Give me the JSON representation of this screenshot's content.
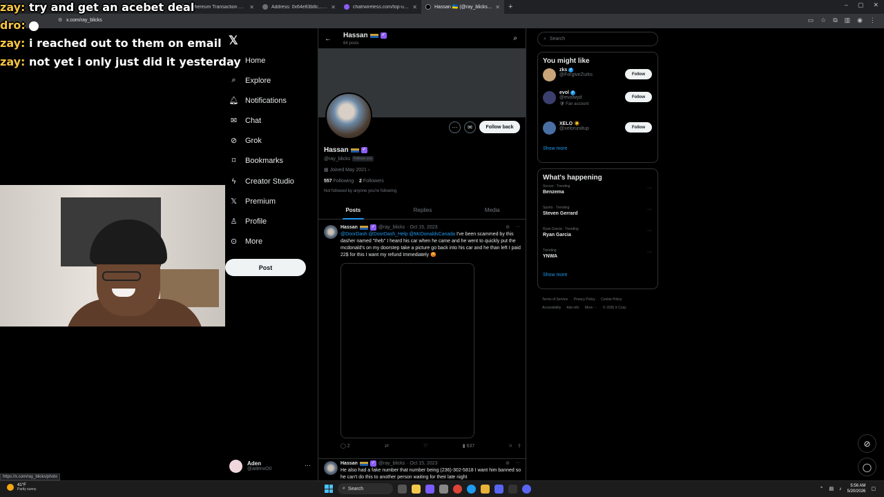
{
  "browser": {
    "tabs": [
      {
        "title": "",
        "active": false
      },
      {
        "title": "Ethereum Transaction Hash (Tx...",
        "active": false
      },
      {
        "title": "Address: 0x64e83b8c...b8583f...",
        "active": false
      },
      {
        "title": "chatrwireless.com/top-up/gue...",
        "active": false
      },
      {
        "title": "Hassan 🇺🇦 (@ray_blicks) / X",
        "active": true
      }
    ],
    "url": "x.com/ray_blicks",
    "status_url": "https://x.com/ray_blicks/photo"
  },
  "stream_chat": [
    {
      "name": "zay:",
      "text": "try and get an acebet deal"
    },
    {
      "name": "dro:",
      "text": ""
    },
    {
      "name": "zay:",
      "text": "i reached out to them on email"
    },
    {
      "name": "zay:",
      "text": "not yet i only just did it yesterday"
    }
  ],
  "nav": {
    "items": [
      {
        "label": "Home",
        "icon": "home-icon"
      },
      {
        "label": "Explore",
        "icon": "search-icon"
      },
      {
        "label": "Notifications",
        "icon": "bell-icon"
      },
      {
        "label": "Chat",
        "icon": "mail-icon"
      },
      {
        "label": "Grok",
        "icon": "grok-icon"
      },
      {
        "label": "Bookmarks",
        "icon": "bookmark-icon"
      },
      {
        "label": "Creator Studio",
        "icon": "lightning-icon"
      },
      {
        "label": "Premium",
        "icon": "x-icon"
      },
      {
        "label": "Profile",
        "icon": "person-icon"
      },
      {
        "label": "More",
        "icon": "more-circle-icon"
      }
    ],
    "post_label": "Post",
    "account": {
      "name": "Aden",
      "handle": "@adenxO0"
    }
  },
  "profile": {
    "header_name": "Hassan",
    "post_count": "64 posts",
    "name": "Hassan",
    "handle": "@ray_blicks",
    "follows_you": "Follows you",
    "joined": "Joined May 2021",
    "following_count": "557",
    "following_label": "Following",
    "followers_count": "2",
    "followers_label": "Followers",
    "not_followed": "Not followed by anyone you're following",
    "follow_back_label": "Follow back",
    "tabs": [
      "Posts",
      "Replies",
      "Media"
    ]
  },
  "tweets": [
    {
      "name": "Hassan",
      "handle": "@ray_blicks",
      "date": "· Oct 15, 2023",
      "mentions": "@DoorDash @DoorDash_Help @McDonaldsCanada",
      "text": " I've been scammed by this dasher named \"Iheb\" I heard his car when he came and he went to quickly put the mcdonald's on my doorstep take a picture go back into his car and he than left I paid 22$ for this I want my refund Immediately 😡",
      "replies": "2",
      "views": "637"
    },
    {
      "name": "Hassan",
      "handle": "@ray_blicks",
      "date": "· Oct 15, 2023",
      "mentions": "",
      "text": "He also had a fake number that number being (236)-302-5818 I want him banned so he can't do this to another person waiting for their late night"
    }
  ],
  "right": {
    "search_placeholder": "Search",
    "wtf_title": "You might like",
    "wtf": [
      {
        "name": "zks",
        "handle": "@ForgiveZurks",
        "sub": "",
        "verified": true,
        "color": "#c9a47a"
      },
      {
        "name": "evol",
        "handle": "@evolwyd",
        "sub": "Fan account",
        "verified": true,
        "color": "#3b3f6e"
      },
      {
        "name": "XELO ☀️",
        "handle": "@xeloruniitup",
        "sub": "",
        "verified": false,
        "color": "#4a6fa5"
      }
    ],
    "follow_label": "Follow",
    "show_more": "Show more",
    "happening_title": "What's happening",
    "trends": [
      {
        "context": "Soccer · Trending",
        "title": "Benzema"
      },
      {
        "context": "Sports · Trending",
        "title": "Steven Gerrard"
      },
      {
        "context": "Ryan Garcia · Trending",
        "title": "Ryan Garcia"
      },
      {
        "context": "Trending",
        "title": "YNWA"
      }
    ],
    "footer": [
      "Terms of Service",
      "Privacy Policy",
      "Cookie Policy",
      "Accessibility",
      "Ads info",
      "More ···",
      "© 2026 X Corp."
    ]
  },
  "taskbar": {
    "temp": "41°F",
    "condition": "Partly sunny",
    "search": "Search",
    "time": "5:56 AM",
    "date": "5/20/2026"
  }
}
